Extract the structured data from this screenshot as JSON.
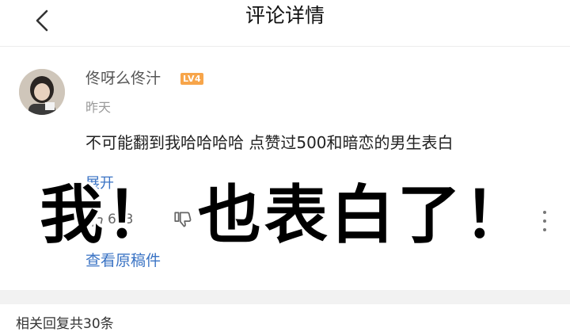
{
  "header": {
    "title": "评论详情",
    "back_icon": "chevron-left-icon"
  },
  "comment": {
    "username": "佟呀么佟汁",
    "level_badge": "LV4",
    "level_badge_color": "#f7a54a",
    "time": "昨天",
    "text": "不可能翻到我哈哈哈哈 点赞过500和暗恋的男生表白",
    "expand_label": "展开",
    "like_count": "633",
    "view_original_label": "查看原稿件",
    "link_color": "#3a73c4"
  },
  "related": {
    "heading": "相关回复共30条"
  },
  "overlay": {
    "caption": "我！ 也表白了！"
  }
}
